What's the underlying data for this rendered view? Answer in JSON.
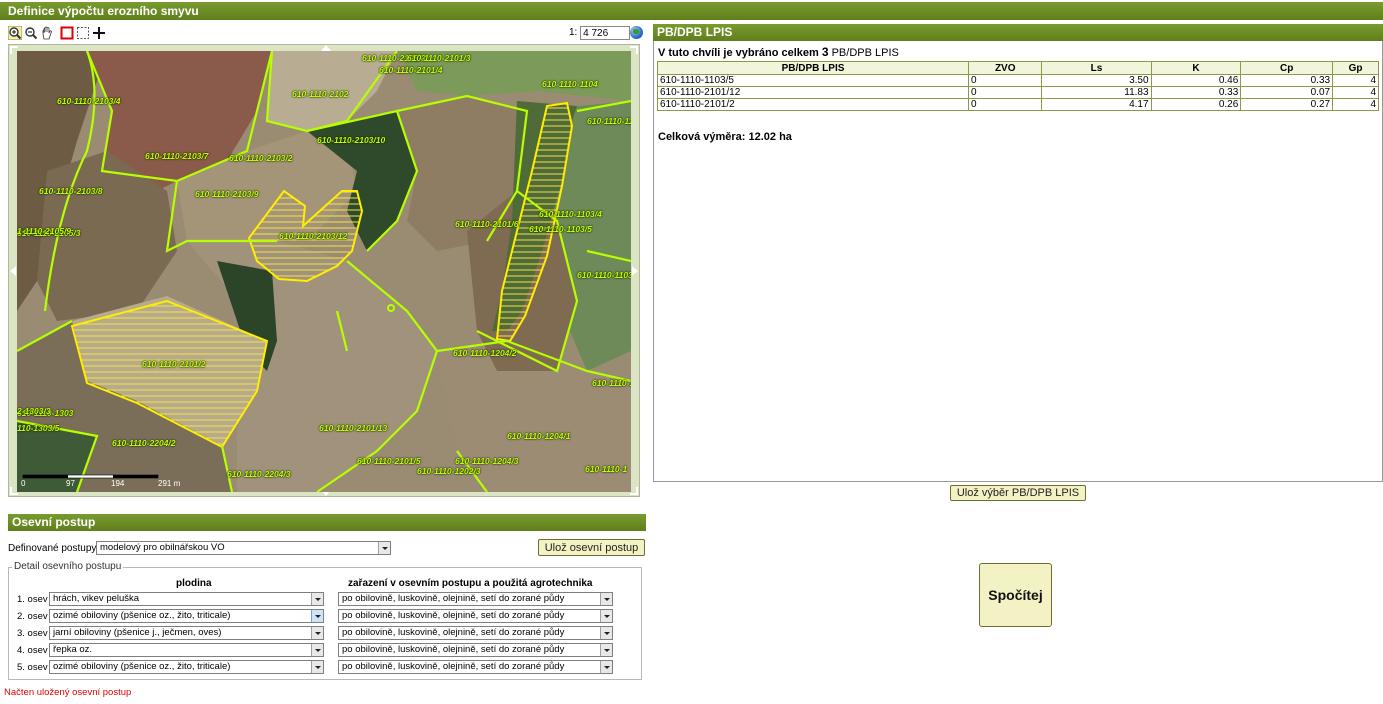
{
  "window": {
    "title": "Definice výpočtu erozního smyvu"
  },
  "map": {
    "scale_prefix": "1:",
    "scale_value": "4 726",
    "scalebar_ticks": [
      "0",
      "97",
      "194",
      "291 m"
    ],
    "parcel_labels": [
      "610-1110-2103/4",
      "610-1110-2102",
      "610-1110-2103/7",
      "610-1110-2103/2",
      "610-1110-2103/10",
      "610-1110-2103/3",
      "610-1110-2103/9",
      "610-1110-2103/8",
      "610-1110-2103/12",
      "610-1110-2101/6",
      "610-1110-1103/4",
      "610-1110-1103/5",
      "610-1110-1104",
      "610-1110-1103/3",
      "610-1110-2101/2",
      "610-1110-1204/2",
      "610-1110-2204/2",
      "610-1110-2101/13",
      "610-1110-1204/1",
      "610-1110-1204/3",
      "610-1110-2101/5",
      "610-1110-1202/3",
      "610-1110-2204/3",
      "610-1110-1303",
      "610-1110-2101/4",
      "610-1110-2101/3",
      "610-1110-1103",
      "610-1110-120",
      "610-1110-1",
      "610-1110-2105/3",
      "1-1110-2105/9",
      "2-1303/3",
      "110-1303/5"
    ]
  },
  "lpis_panel": {
    "title": "PB/DPB LPIS",
    "selection_prefix": "V tuto chvíli je vybráno celkem",
    "selection_count": "3",
    "selection_suffix": "PB/DPB LPIS",
    "columns": [
      "PB/DPB LPIS",
      "ZVO",
      "Ls",
      "K",
      "Cp",
      "Gp"
    ],
    "rows": [
      [
        "610-1110-1103/5",
        "0",
        "3.50",
        "0.46",
        "0.33",
        "4"
      ],
      [
        "610-1110-2101/12",
        "0",
        "11.83",
        "0.33",
        "0.07",
        "4"
      ],
      [
        "610-1110-2101/2",
        "0",
        "4.17",
        "0.26",
        "0.27",
        "4"
      ]
    ],
    "total_area": "Celková výměra: 12.02 ha",
    "save_button": "Ulož výběr PB/DPB LPIS"
  },
  "calc_button": "Spočítej",
  "rotation": {
    "title": "Osevní postup",
    "defined_label": "Definované postupy:",
    "defined_value": "modelový pro obilnářskou VO",
    "save_button": "Ulož osevní postup",
    "detail_legend": "Detail osevního postupu",
    "col_crop": "plodina",
    "col_tech": "zařazení v osevním postupu a použitá agrotechnika",
    "rows": [
      {
        "label": "1. osev",
        "crop": "hrách, vikev peluška",
        "tech": "po obilovině, luskovině, olejnině, setí do zorané půdy"
      },
      {
        "label": "2. osev",
        "crop": "ozimé obiloviny (pšenice oz., žito, triticale)",
        "tech": "po obilovině, luskovině, olejnině, setí do zorané půdy"
      },
      {
        "label": "3. osev",
        "crop": "jarní obiloviny (pšenice j., ječmen, oves)",
        "tech": "po obilovině, luskovině, olejnině, setí do zorané půdy"
      },
      {
        "label": "4. osev",
        "crop": "řepka oz.",
        "tech": "po obilovině, luskovině, olejnině, setí do zorané půdy"
      },
      {
        "label": "5. osev",
        "crop": "ozimé obiloviny (pšenice oz., žito, triticale)",
        "tech": "po obilovině, luskovině, olejnině, setí do zorané půdy"
      }
    ],
    "status": "Načten uložený osevní postup"
  },
  "colors": {
    "header_green": "#6b8e23",
    "parcel_outline": "#b6ff00",
    "selected_parcel": "#ffee00",
    "label_green": "#bfff00",
    "status_red": "#e00000"
  }
}
